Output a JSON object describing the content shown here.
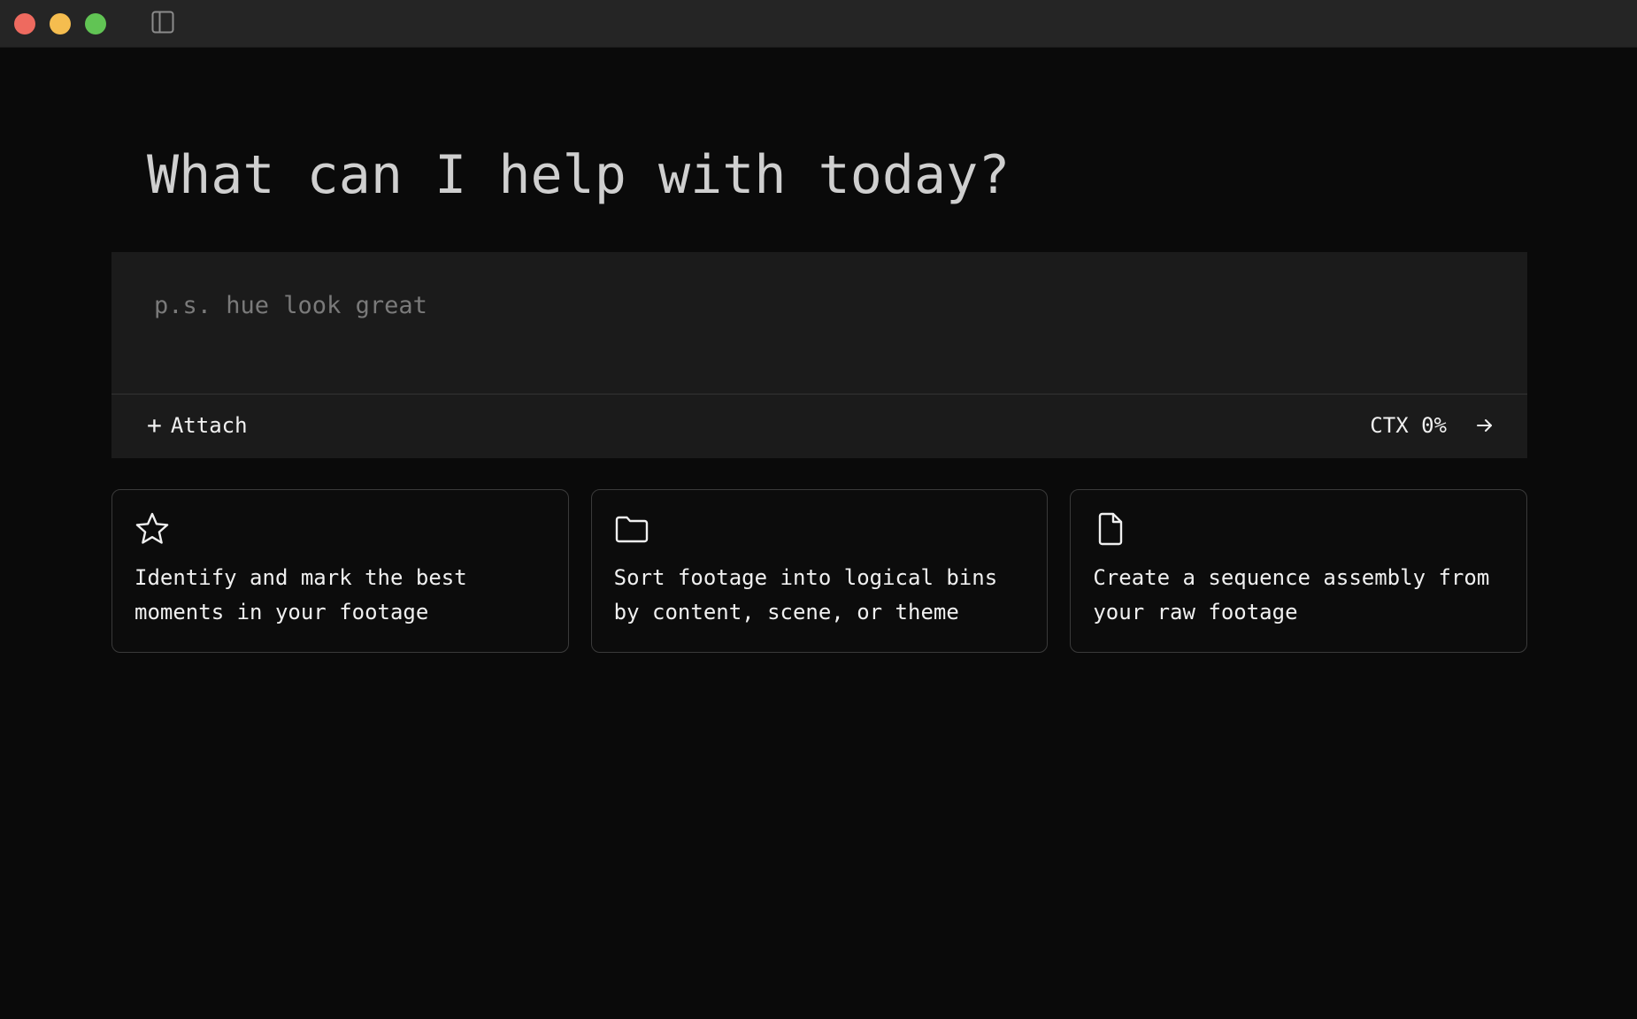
{
  "window": {
    "controls": [
      "close",
      "minimize",
      "maximize"
    ],
    "sidebar_toggle_icon": "sidebar-icon"
  },
  "main": {
    "heading": "What can I help with today?"
  },
  "composer": {
    "placeholder": "p.s. hue look great",
    "value": "",
    "attach_icon": "plus-icon",
    "attach_label": "Attach",
    "ctx_label": "CTX 0%",
    "send_icon": "arrow-right-icon"
  },
  "suggestions": [
    {
      "icon": "star-icon",
      "text": "Identify and mark the best moments in your footage"
    },
    {
      "icon": "folder-icon",
      "text": "Sort footage into logical bins by content, scene, or theme"
    },
    {
      "icon": "file-icon",
      "text": "Create a sequence assembly from your raw footage"
    }
  ],
  "colors": {
    "background": "#0a0a0a",
    "titlebar": "#252525",
    "composer_bg": "#1b1b1b",
    "card_border": "#3a3a3a",
    "close": "#ee6a5f",
    "minimize": "#f5bd4f",
    "maximize": "#61c454"
  }
}
